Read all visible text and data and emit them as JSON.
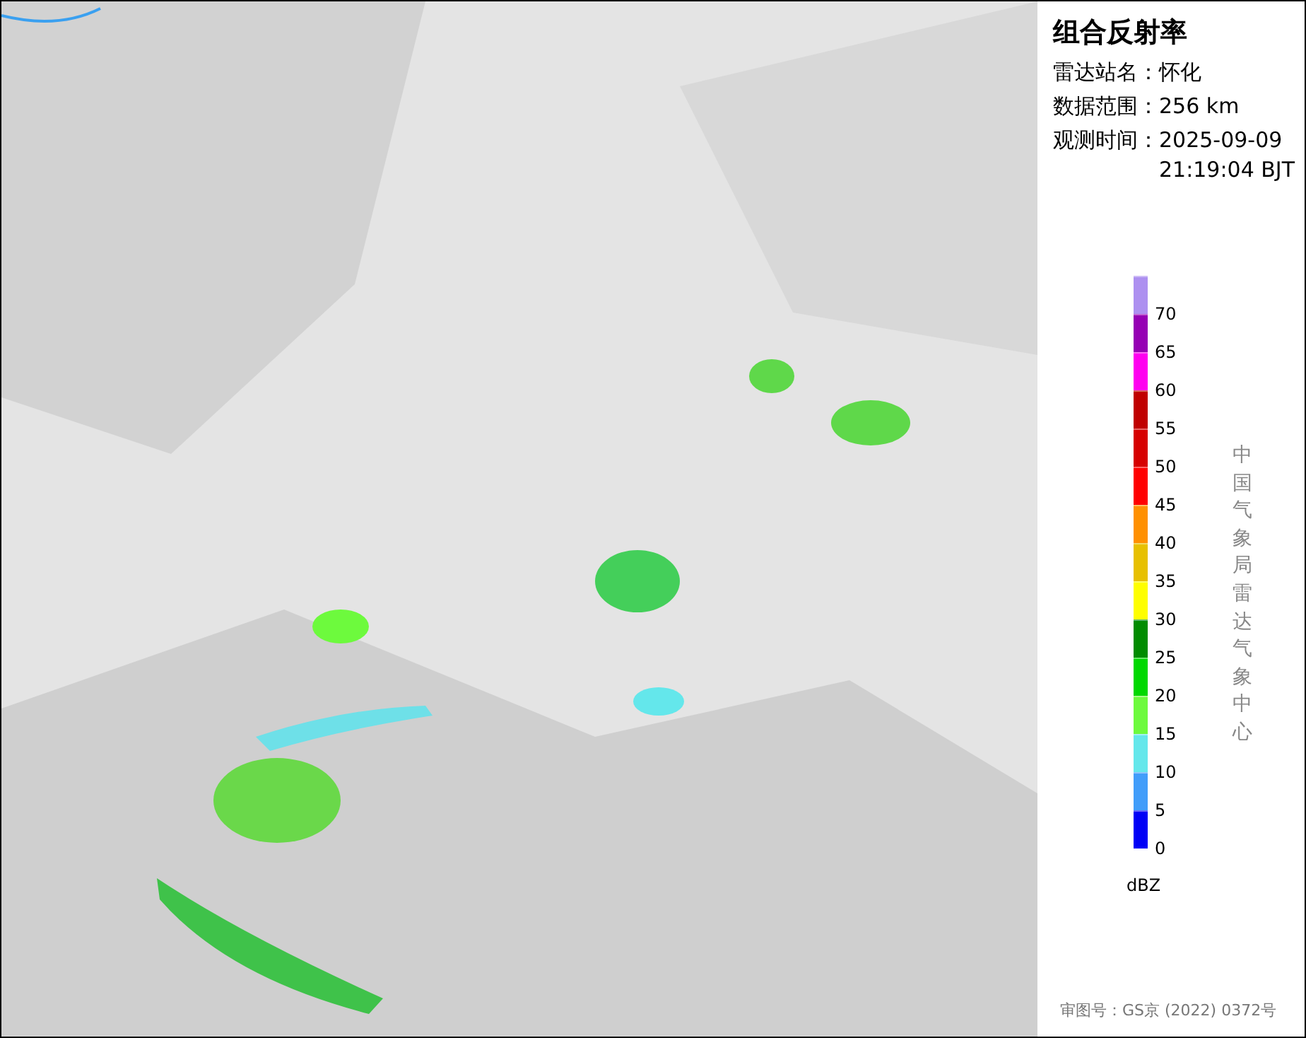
{
  "info": {
    "title": "组合反射率",
    "fields": [
      {
        "label": "雷达站名：",
        "value": "怀化"
      },
      {
        "label": "数据范围：",
        "value": "256 km"
      },
      {
        "label": "观测时间：",
        "value": "2025-09-09 21:19:04 BJT"
      }
    ]
  },
  "legend": {
    "segments": [
      {
        "label": "70",
        "color": "#ad90f0"
      },
      {
        "label": "65",
        "color": "#9600b4"
      },
      {
        "label": "60",
        "color": "#ff00f0"
      },
      {
        "label": "55",
        "color": "#c00000"
      },
      {
        "label": "50",
        "color": "#d60000"
      },
      {
        "label": "45",
        "color": "#ff0000"
      },
      {
        "label": "40",
        "color": "#ff9000"
      },
      {
        "label": "35",
        "color": "#e7c000"
      },
      {
        "label": "30",
        "color": "#fefe00"
      },
      {
        "label": "25",
        "color": "#018c00"
      },
      {
        "label": "20",
        "color": "#00d800"
      },
      {
        "label": "15",
        "color": "#6dfa3d"
      },
      {
        "label": "10",
        "color": "#64e7eb"
      },
      {
        "label": "5",
        "color": "#419dfa"
      },
      {
        "label": "0",
        "color": "#0000f6"
      }
    ],
    "unit": "dBZ"
  },
  "credit": "中国气象局雷达气象中心",
  "approval": "审图号：GS京 (2022) 0372号"
}
